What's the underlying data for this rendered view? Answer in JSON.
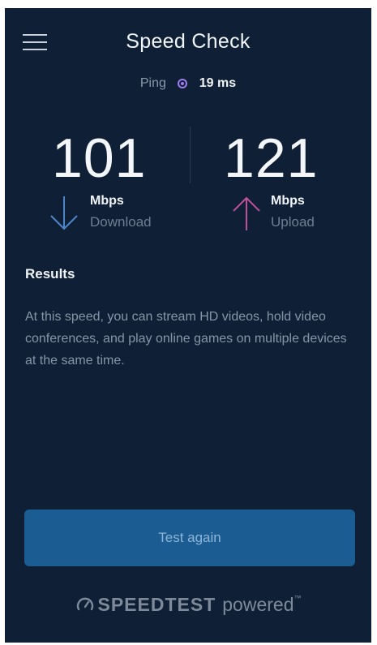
{
  "header": {
    "title": "Speed Check",
    "menu_icon": "hamburger-menu-icon"
  },
  "ping": {
    "label": "Ping",
    "value": "19 ms",
    "indicator_icon": "radio-dot-icon"
  },
  "download": {
    "value": "101",
    "unit": "Mbps",
    "label": "Download",
    "icon": "arrow-down-icon",
    "color": "#4f86c9"
  },
  "upload": {
    "value": "121",
    "unit": "Mbps",
    "label": "Upload",
    "icon": "arrow-up-icon",
    "color": "#c0509a"
  },
  "results": {
    "heading": "Results",
    "body": "At this speed, you can stream HD videos, hold video conferences, and play online games on multiple devices at the same time."
  },
  "actions": {
    "test_again_label": "Test again"
  },
  "footer": {
    "brand": "SPEEDTEST",
    "suffix": "powered",
    "trademark": "™",
    "icon": "speedometer-icon"
  },
  "colors": {
    "background": "#0f2036",
    "button": "#1b5d93",
    "ping_accent": "#9f7cf0"
  }
}
